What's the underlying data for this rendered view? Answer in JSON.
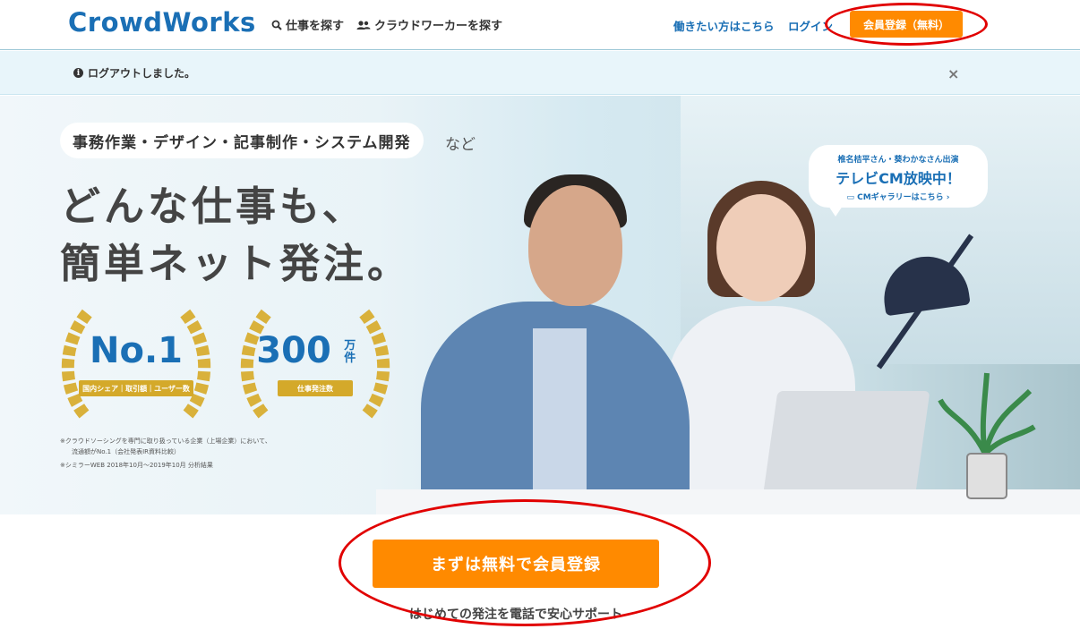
{
  "header": {
    "logo": "CrowdWorks",
    "nav_find_jobs": "仕事を探す",
    "nav_find_workers": "クラウドワーカーを探す",
    "link_work": "働きたい方はこちら",
    "link_login": "ログイン",
    "signup_label": "会員登録（無料）"
  },
  "notice": {
    "message": "ログアウトしました。",
    "close": "×"
  },
  "hero": {
    "tag": "事務作業・デザイン・記事制作・システム開発",
    "tag_suffix": "など",
    "headline_line1": "どんな仕事も、",
    "headline_line2": "簡単ネット発注。",
    "award1_main": "No.1",
    "award1_sub": "国内シェア｜取引額｜ユーザー数",
    "award2_main": "300",
    "award2_unit": "万件",
    "award2_sub": "仕事発注数",
    "footnote1": "※クラウドソーシングを専門に取り扱っている企業（上場企業）において、",
    "footnote2": "流通額がNo.1（会社発表IR資料比較）",
    "footnote3": "※シミラーWEB 2018年10月〜2019年10月 分析結果",
    "tv_line1": "椎名桔平さん・葵わかなさん出演",
    "tv_line2": "テレビCM放映中！",
    "tv_line3": "CMギャラリーはこちら ›"
  },
  "cta": {
    "button": "まずは無料で会員登録",
    "sub": "はじめての発注を電話で安心サポート"
  },
  "colors": {
    "accent": "#ff8a00",
    "brand": "#1a6fb5",
    "annotation": "#e10000"
  }
}
